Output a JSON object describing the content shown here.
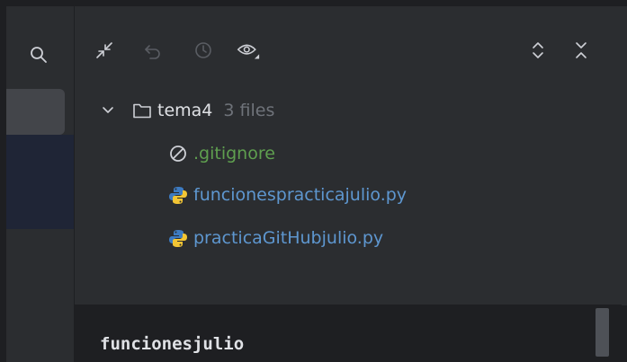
{
  "left_panel": {
    "search_icon": "search-icon"
  },
  "toolbar": {
    "icons": [
      "collapse-icon",
      "undo-icon",
      "history-icon",
      "eye-icon",
      "expand-collapse-icon",
      "close-icon"
    ]
  },
  "tree": {
    "folder": {
      "name": "tema4",
      "count": "3 files"
    },
    "files": [
      {
        "name": ".gitignore",
        "icon": "ignore-icon"
      },
      {
        "name": "funcionespracticajulio.py",
        "icon": "python-icon"
      },
      {
        "name": "practicaGitHubjulio.py",
        "icon": "python-icon"
      }
    ]
  },
  "commit": {
    "message": "funcionesjulio"
  },
  "colors": {
    "background": "#2b2d30",
    "selected": "#43454a",
    "ignored_file": "#5f9f4f",
    "modified_file": "#5e97d0",
    "muted": "#6f737a"
  }
}
